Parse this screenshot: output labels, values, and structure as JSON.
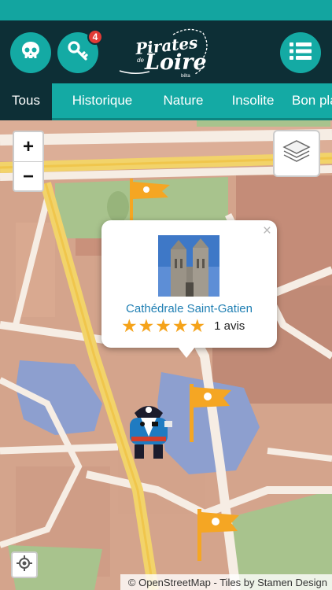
{
  "header": {
    "logo_line1": "Pirates",
    "logo_line2": "de",
    "logo_line3": "Loire",
    "logo_tag": "bêta",
    "keys_badge": "4",
    "icons": [
      "skull-icon",
      "keys-icon",
      "list-menu-icon"
    ]
  },
  "tabs": [
    {
      "label": "Tous",
      "active": true
    },
    {
      "label": "Historique",
      "active": false
    },
    {
      "label": "Nature",
      "active": false
    },
    {
      "label": "Insolite",
      "active": false
    },
    {
      "label": "Bon plan",
      "active": false
    }
  ],
  "map": {
    "zoom_in": "+",
    "zoom_out": "−",
    "popup": {
      "title": "Cathédrale Saint-Gatien",
      "close": "×",
      "rating": 5,
      "stars": [
        "★",
        "★",
        "★",
        "★",
        "★"
      ],
      "reviews": "1 avis"
    },
    "attribution": "© OpenStreetMap - Tiles by Stamen Design"
  },
  "colors": {
    "teal": "#14aaa4",
    "navy": "#0d2f36",
    "badge": "#e23b36",
    "link": "#1f7fb3",
    "star": "#f5a31a"
  }
}
